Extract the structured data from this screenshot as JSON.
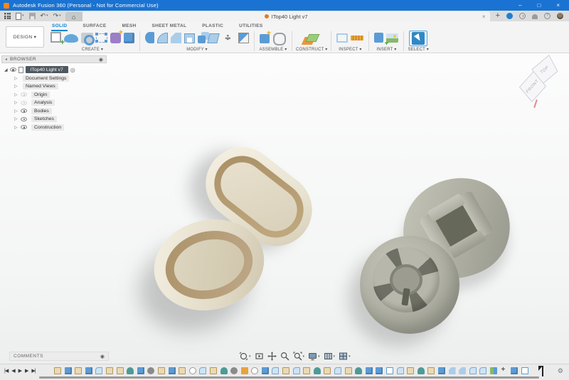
{
  "window": {
    "title": "Autodesk Fusion 360 (Personal - Not for Commercial Use)",
    "minimize": "–",
    "maximize": "□",
    "close": "×"
  },
  "tab_bar": {
    "document_tab": "ITop40 Light v7",
    "tab_close": "×",
    "new_tab": "+"
  },
  "quick_access": {
    "undo_glyph": "↶",
    "redo_glyph": "↷",
    "home_glyph": "⌂",
    "caret": "▾"
  },
  "ribbon": {
    "design_button": "DESIGN ▾",
    "tabs": [
      {
        "label": "SOLID",
        "state": "active"
      },
      {
        "label": "SURFACE",
        "state": "inactive"
      },
      {
        "label": "MESH",
        "state": "inactive"
      },
      {
        "label": "SHEET METAL",
        "state": "inactive"
      },
      {
        "label": "PLASTIC",
        "state": "inactive"
      },
      {
        "label": "UTILITIES",
        "state": "inactive"
      }
    ],
    "groups": [
      {
        "label": "CREATE ▾",
        "icons": [
          "create-sketch-icon",
          "create-form-icon",
          "create-emboss-icon",
          "create-derive-icon",
          "create-paste-icon",
          "create-box-icon"
        ]
      },
      {
        "label": "MODIFY ▾",
        "icons": [
          "press-pull-icon",
          "fillet-icon",
          "chamfer-icon",
          "shell-icon",
          "combine-icon",
          "offset-face-icon",
          "move-copy-icon",
          "split-body-icon"
        ]
      },
      {
        "label": "ASSEMBLE ▾",
        "icons": [
          "new-component-icon",
          "joint-icon"
        ]
      },
      {
        "label": "CONSTRUCT ▾",
        "icons": [
          "construction-plane-icon"
        ]
      },
      {
        "label": "INSPECT ▾",
        "icons": [
          "measure-icon",
          "section-analysis-icon"
        ]
      },
      {
        "label": "INSERT ▾",
        "icons": [
          "insert-mesh-icon",
          "canvas-icon"
        ]
      },
      {
        "label": "SELECT ▾",
        "icons": [
          "select-tool-icon"
        ]
      }
    ]
  },
  "browser": {
    "title": "BROWSER",
    "collapse_glyph": "◂",
    "root_label": "ITop40 Light v7",
    "items": [
      {
        "label": "Document Settings",
        "icon": "gear-icon",
        "eye": "no-eye"
      },
      {
        "label": "Named Views",
        "icon": "folder-icon",
        "eye": "no-eye"
      },
      {
        "label": "Origin",
        "icon": "folder-icon",
        "eye": "dim"
      },
      {
        "label": "Analysis",
        "icon": "folder-icon",
        "eye": "dim"
      },
      {
        "label": "Bodies",
        "icon": "folder-icon",
        "eye": "on"
      },
      {
        "label": "Sketches",
        "icon": "folder-icon",
        "eye": "on"
      },
      {
        "label": "Construction",
        "icon": "folder-icon",
        "eye": "on"
      }
    ]
  },
  "viewcube": {
    "top_face": "TOP",
    "front_face": "FRONT"
  },
  "comments": {
    "label": "COMMENTS"
  },
  "nav_bar": {
    "icons": [
      "orbit-icon",
      "look-at-icon",
      "pan-icon",
      "zoom-icon",
      "fit-icon",
      "display-settings-icon",
      "grid-settings-icon",
      "viewports-icon"
    ]
  },
  "timeline": {
    "playback": [
      {
        "name": "go-to-start-button",
        "glyph": "|◀"
      },
      {
        "name": "step-back-button",
        "glyph": "◀"
      },
      {
        "name": "play-button",
        "glyph": "▶"
      },
      {
        "name": "step-forward-button",
        "glyph": "▶"
      },
      {
        "name": "go-to-end-button",
        "glyph": "▶|"
      }
    ],
    "features": [
      "sketch",
      "extrude",
      "sketch",
      "extrude",
      "fillet",
      "sketch",
      "sketch",
      "revolve",
      "extrude",
      "hole",
      "sketch",
      "extrude",
      "sketch",
      "form",
      "fillet",
      "sketch",
      "revolve",
      "hole",
      "offset",
      "form",
      "extrude",
      "fillet",
      "sketch",
      "fillet",
      "sketch",
      "revolve",
      "sketch",
      "fillet",
      "sketch",
      "revolve",
      "extrude",
      "extrude",
      "pattern",
      "fillet",
      "sketch",
      "revolve",
      "sketch",
      "extrude",
      "chamfer",
      "chamfer",
      "fillet",
      "fillet",
      "combine",
      "move",
      "extrude",
      "pattern"
    ]
  },
  "colors": {
    "titlebar_blue": "#1a73d2",
    "active_tab_blue": "#0a84d0",
    "select_highlight": "#2f88c5",
    "part_cream": "#ece6d6",
    "part_ring_tan": "#ab9269",
    "part_gray": "#b0b1a4",
    "canvas_bg": "#f4f5f5"
  }
}
